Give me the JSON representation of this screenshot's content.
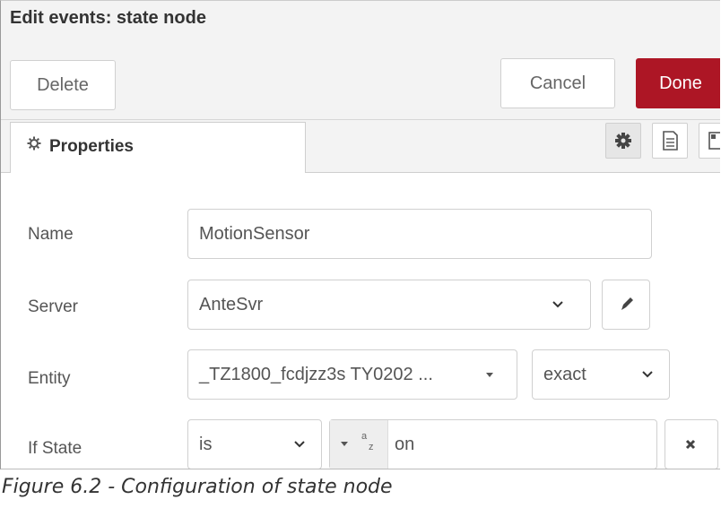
{
  "dialog": {
    "title": "Edit events: state node"
  },
  "toolbar": {
    "delete_label": "Delete",
    "cancel_label": "Cancel",
    "done_label": "Done"
  },
  "tabs": {
    "properties_label": "Properties"
  },
  "tab_icons": [
    "gear-icon",
    "description-icon",
    "appearance-icon"
  ],
  "form": {
    "name": {
      "label": "Name",
      "value": "MotionSensor"
    },
    "server": {
      "label": "Server",
      "value": "AnteSvr"
    },
    "entity": {
      "label": "Entity",
      "value": "_TZ1800_fcdjzz3s TY0202 ...",
      "match_mode": "exact"
    },
    "if_state": {
      "label": "If State",
      "operator": "is",
      "type_symbol": "a z",
      "value": "on"
    }
  },
  "caption": "Figure 6.2 - Configuration of state node",
  "colors": {
    "done": "#ad1625",
    "chrome": "#f3f3f3",
    "border": "#d0d0d0"
  }
}
